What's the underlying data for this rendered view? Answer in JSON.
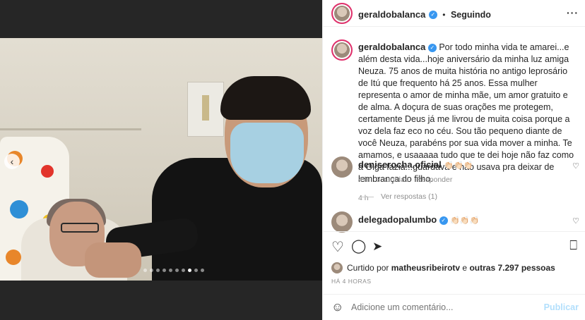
{
  "header": {
    "username": "geraldobalanca",
    "separator": "•",
    "follow_status": "Seguindo",
    "more_glyph": "···"
  },
  "caption": {
    "username": "geraldobalanca",
    "text": "Por todo minha vida te amarei...e além desta vida...hoje aniversário da minha luz amiga Neuza. 75 anos de muita história no antigo leprosário de Itú que frequento há 25 anos. Essa mulher representa o amor de minha mãe, um amor gratuito e de alma. A doçura de suas orações me protegem, certamente Deus já me livrou de muita coisa porque a voz dela faz eco no céu. Sou tão pequeno diante de você Neuza, parabéns por sua vida mover a minha. Te amamos, e usaaaaa tudo que te dei hoje não faz como a Olga fazia...guardava e não usava pra deixar de lembrança do filho.",
    "time": "4 h"
  },
  "comments": [
    {
      "username": "deniserocha.oficial",
      "emoji": "👏🏻👏🏻👏🏻",
      "time": "4 h",
      "likes": "3 curtidas",
      "reply_label": "Responder",
      "view_replies": "Ver respostas (1)"
    },
    {
      "username": "delegadopalumbo",
      "emoji": "👏🏻👏🏻👏🏻"
    }
  ],
  "icons": {
    "heart": "heart-icon",
    "comment": "comment-icon",
    "share": "share-icon",
    "save": "bookmark-icon",
    "emoji": "emoji-icon",
    "prev": "chevron-left-icon"
  },
  "likes": {
    "prefix": "Curtido por",
    "user": "matheusribeirotv",
    "middle": "e",
    "others": "outras 7.297 pessoas"
  },
  "time_ago": "HÁ 4 HORAS",
  "comment_input": {
    "placeholder": "Adicione um comentário...",
    "publish_label": "Publicar"
  },
  "carousel": {
    "total": 10,
    "active_index": 7
  },
  "colors": {
    "verified": "#3897f0",
    "link_blue": "#0095f6",
    "publish_disabled": "#b2dffc"
  }
}
